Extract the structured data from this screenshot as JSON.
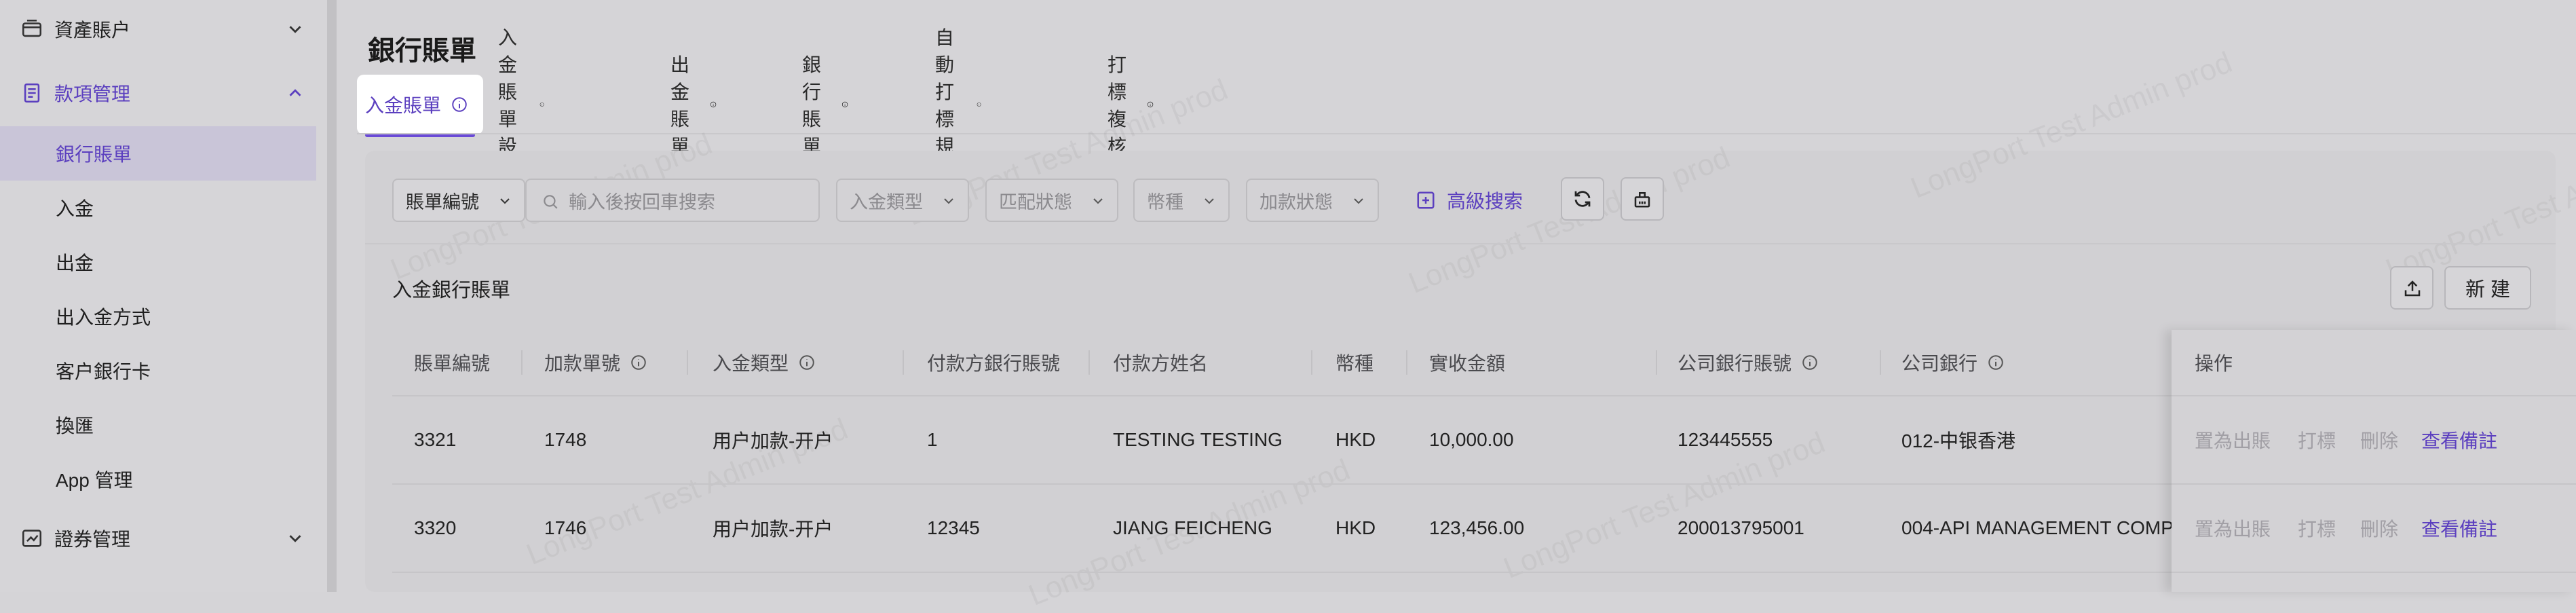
{
  "sidebar": {
    "groups": [
      {
        "label": "資產賬户",
        "expanded": false
      },
      {
        "label": "款項管理",
        "expanded": true
      },
      {
        "label": "證券管理",
        "expanded": false
      }
    ],
    "items": [
      {
        "label": "銀行賬單",
        "active": true
      },
      {
        "label": "入金"
      },
      {
        "label": "出金"
      },
      {
        "label": "出入金方式"
      },
      {
        "label": "客户銀行卡"
      },
      {
        "label": "換匯"
      },
      {
        "label": "App 管理"
      }
    ]
  },
  "page": {
    "title": "銀行賬單"
  },
  "tabs": [
    {
      "label": "入金賬單",
      "active": true
    },
    {
      "label": "入金賬單設置"
    },
    {
      "label": "出金賬單"
    },
    {
      "label": "銀行賬單"
    },
    {
      "label": "自動打標規則"
    },
    {
      "label": "打標複核"
    }
  ],
  "filters": {
    "field_select": "賬單編號",
    "search_placeholder": "輸入後按回車搜索",
    "deposit_type": "入金類型",
    "match_status": "匹配狀態",
    "currency": "幣種",
    "deposit_status": "加款狀態",
    "advanced_search": "高級搜索"
  },
  "section": {
    "title": "入金銀行賬單",
    "new_label": "新 建"
  },
  "table": {
    "columns": [
      "賬單編號",
      "加款單號",
      "入金類型",
      "付款方銀行賬號",
      "付款方姓名",
      "幣種",
      "實收金額",
      "公司銀行賬號",
      "公司銀行",
      "操作"
    ],
    "rows": [
      {
        "bill_no": "3321",
        "add_no": "1748",
        "deposit_type": "用户加款-开户",
        "payer_account": "1",
        "payer_name": "TESTING TESTING",
        "currency": "HKD",
        "amount": "10,000.00",
        "company_account": "123445555",
        "company_bank": "012-中银香港"
      },
      {
        "bill_no": "3320",
        "add_no": "1746",
        "deposit_type": "用户加款-开户",
        "payer_account": "12345",
        "payer_name": "JIANG FEICHENG",
        "currency": "HKD",
        "amount": "123,456.00",
        "company_account": "200013795001",
        "company_bank": "004-API MANAGEMENT COMP"
      }
    ],
    "ops": {
      "mark_out": "置為出賬",
      "tag": "打標",
      "delete": "刪除",
      "view_note": "查看備註"
    }
  },
  "watermark": "LongPort Test Admin prod",
  "colors": {
    "accent": "#5b3fbf",
    "background": "#d5d4d7"
  }
}
